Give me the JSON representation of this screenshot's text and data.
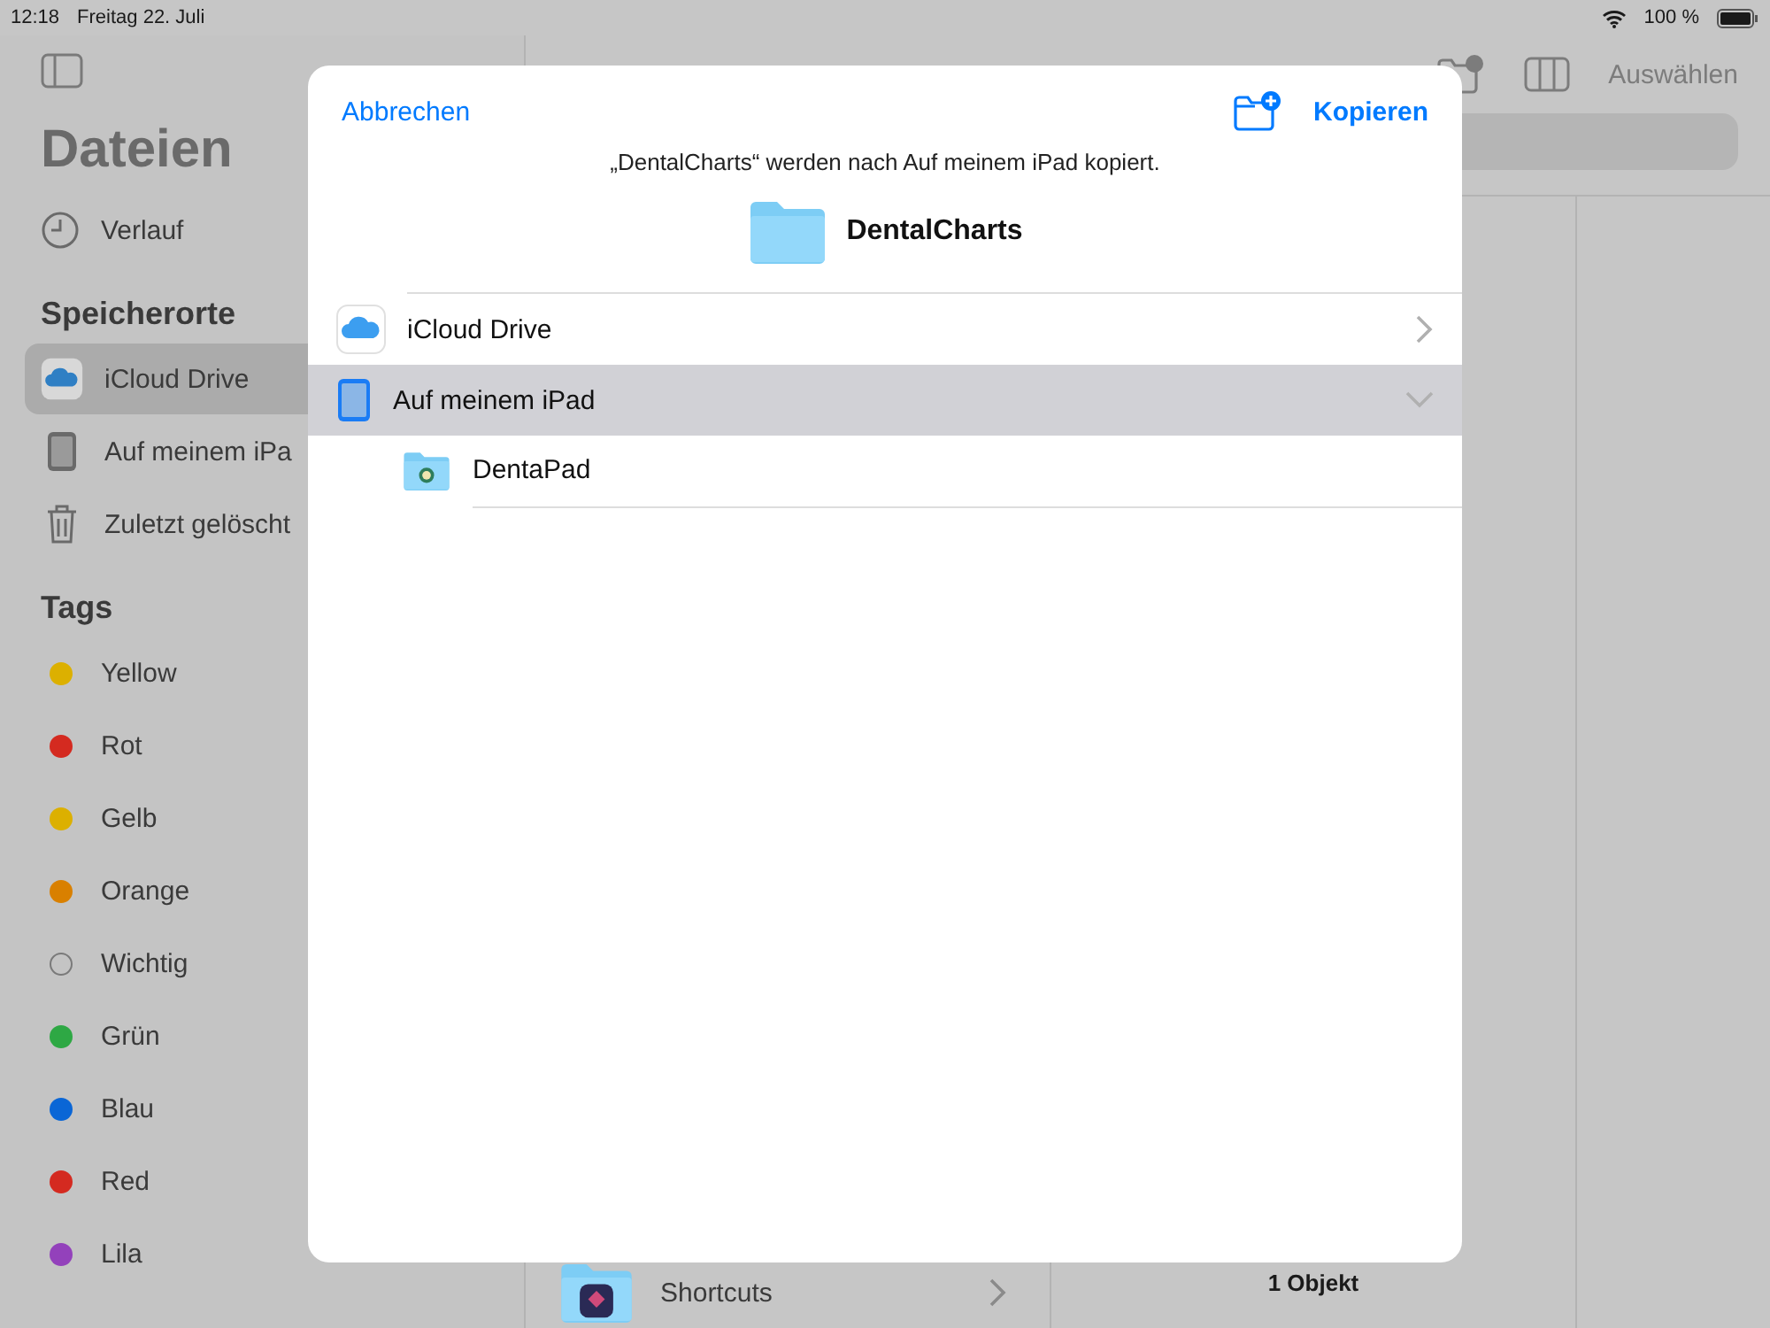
{
  "status_bar": {
    "time": "12:18",
    "date": "Freitag 22. Juli",
    "battery": "100 %"
  },
  "sidebar": {
    "title": "Dateien",
    "recents": "Verlauf",
    "locations_header": "Speicherorte",
    "locations": [
      {
        "label": "iCloud Drive",
        "kind": "icloud",
        "selected": true
      },
      {
        "label": "Auf meinem iPa",
        "kind": "ipad",
        "selected": false
      },
      {
        "label": "Zuletzt gelöscht",
        "kind": "trash",
        "selected": false
      }
    ],
    "tags_header": "Tags",
    "tags": [
      {
        "label": "Yellow",
        "kind": "dot",
        "color": "#dcb000"
      },
      {
        "label": "Rot",
        "kind": "dot",
        "color": "#d42a20"
      },
      {
        "label": "Gelb",
        "kind": "dot",
        "color": "#dcb000"
      },
      {
        "label": "Orange",
        "kind": "dot",
        "color": "#d98000"
      },
      {
        "label": "Wichtig",
        "kind": "outline"
      },
      {
        "label": "Grün",
        "kind": "dot",
        "color": "#2ea844"
      },
      {
        "label": "Blau",
        "kind": "dot",
        "color": "#0a66d6"
      },
      {
        "label": "Red",
        "kind": "dot",
        "color": "#d42a20"
      },
      {
        "label": "Lila",
        "kind": "dot",
        "color": "#9341bb"
      }
    ]
  },
  "toolbar": {
    "select": "Auswählen"
  },
  "browser": {
    "folders": [
      {
        "label": "Shortcuts"
      }
    ],
    "item_count": "1 Objekt"
  },
  "dialog": {
    "cancel": "Abbrechen",
    "confirm": "Kopieren",
    "message": "„DentalCharts“ werden nach Auf meinem iPad kopiert.",
    "item": "DentalCharts",
    "locations": [
      {
        "label": "iCloud Drive",
        "kind": "icloud",
        "expanded": false,
        "selected": false
      },
      {
        "label": "Auf meinem iPad",
        "kind": "ipad",
        "expanded": true,
        "selected": true,
        "children": [
          {
            "label": "DentaPad"
          }
        ]
      }
    ]
  }
}
